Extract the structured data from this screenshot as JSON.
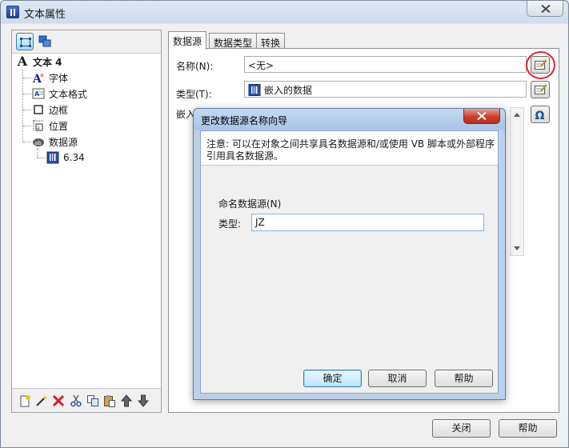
{
  "window": {
    "title": "文本属性",
    "icon": "barcode-app-icon"
  },
  "tree": {
    "root_label": "文本 4",
    "items": [
      {
        "label": "字体",
        "icon": "font-icon"
      },
      {
        "label": "文本格式",
        "icon": "text-format-icon"
      },
      {
        "label": "边框",
        "icon": "border-icon"
      },
      {
        "label": "位置",
        "icon": "position-icon"
      },
      {
        "label": "数据源",
        "icon": "data-source-icon"
      }
    ],
    "sub_item": {
      "label": "6.34",
      "icon": "embedded-data-icon"
    }
  },
  "tabs": [
    {
      "label": "数据源",
      "active": true
    },
    {
      "label": "数据类型",
      "active": false
    },
    {
      "label": "转换",
      "active": false
    }
  ],
  "fields": {
    "name_label": "名称(N):",
    "name_value": "<无>",
    "type_label": "类型(T):",
    "type_value": "嵌入的数据",
    "embed_label": "嵌入"
  },
  "footer": {
    "close_label": "关闭",
    "help_label": "帮助"
  },
  "wizard": {
    "title": "更改数据源名称向导",
    "note_line1": "注意: 可以在对象之间共享具名数据源和/或使用 VB 脚本或外部程序",
    "note_line2": "引用具名数据源。",
    "name_section_label": "命名数据源(N)",
    "type_label": "类型:",
    "type_value": "JZ",
    "ok_label": "确定",
    "cancel_label": "取消",
    "help_label": "帮助"
  },
  "colors": {
    "highlight_ring": "#e02525",
    "dialog_frame": "#a9c4e6",
    "input_focus_border": "#7eb4ea"
  }
}
